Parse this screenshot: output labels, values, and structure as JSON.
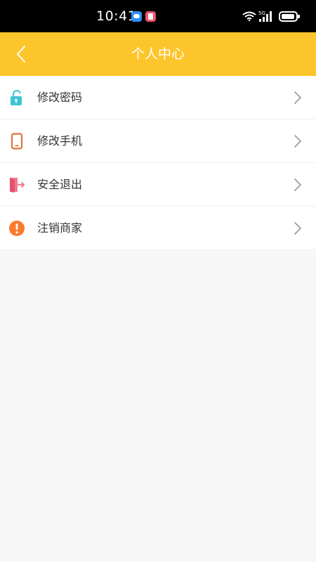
{
  "status_bar": {
    "time": "10:41",
    "network": "5G"
  },
  "header": {
    "title": "个人中心",
    "back_icon": "chevron-left-icon"
  },
  "menu": {
    "items": [
      {
        "label": "修改密码",
        "icon": "unlock-icon",
        "icon_color": "#3ec4d6"
      },
      {
        "label": "修改手机",
        "icon": "phone-icon",
        "icon_color": "#e0743a"
      },
      {
        "label": "安全退出",
        "icon": "logout-icon",
        "icon_color": "#f17a8e"
      },
      {
        "label": "注销商家",
        "icon": "alert-icon",
        "icon_color": "#fb7a2c"
      }
    ]
  },
  "colors": {
    "header_bg": "#fdc52c",
    "page_bg": "#f7f7f7"
  }
}
